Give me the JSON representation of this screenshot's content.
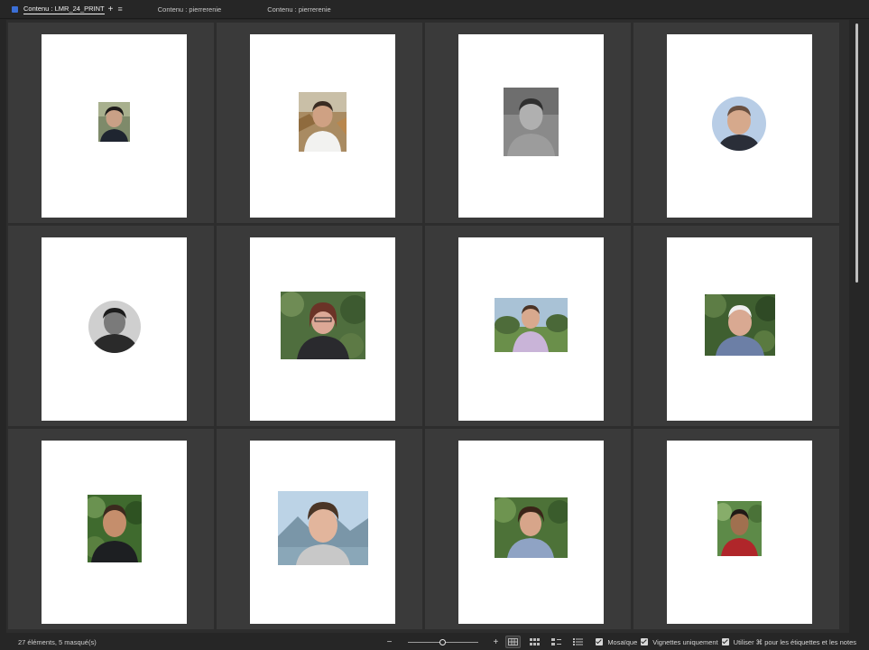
{
  "tabs": [
    {
      "label": "Contenu : LMR_24_PRINT",
      "active": true
    },
    {
      "label": "Contenu : pierrerenie",
      "active": false
    },
    {
      "label": "Contenu : pierrerenie",
      "active": false
    }
  ],
  "tab_actions": {
    "add_icon": "+",
    "menu_icon": "≡"
  },
  "thumbnails": [
    {
      "subject": "woman-short-dark-hair",
      "shape": "rect"
    },
    {
      "subject": "man-white-shirt-smiling",
      "shape": "rect"
    },
    {
      "subject": "man-bw-grey-tshirt",
      "shape": "rect"
    },
    {
      "subject": "man-circle-portrait",
      "shape": "circle"
    },
    {
      "subject": "man-bw-circle-portrait",
      "shape": "circle"
    },
    {
      "subject": "woman-glasses-foliage",
      "shape": "rect"
    },
    {
      "subject": "man-pink-shirt-field",
      "shape": "rect"
    },
    {
      "subject": "older-man-white-hair",
      "shape": "rect"
    },
    {
      "subject": "man-green-foliage",
      "shape": "rect"
    },
    {
      "subject": "young-man-mountains",
      "shape": "rect"
    },
    {
      "subject": "woman-curly-hair-foliage",
      "shape": "rect"
    },
    {
      "subject": "man-red-shirt-foliage",
      "shape": "rect"
    }
  ],
  "status": {
    "count_text": "27 éléments, 5 masqué(s)",
    "zoom_minus": "−",
    "zoom_plus": "+",
    "zoom_level": 0.5
  },
  "options": {
    "mosaic_label": "Mosaïque",
    "thumbnails_only_label": "Vignettes uniquement",
    "use_cmd_label": "Utiliser ⌘ pour les étiquettes et les notes"
  },
  "colors": {
    "accent": "#3b6fd6",
    "background": "#262626",
    "cell": "#3a3a3a",
    "page": "#ffffff"
  }
}
